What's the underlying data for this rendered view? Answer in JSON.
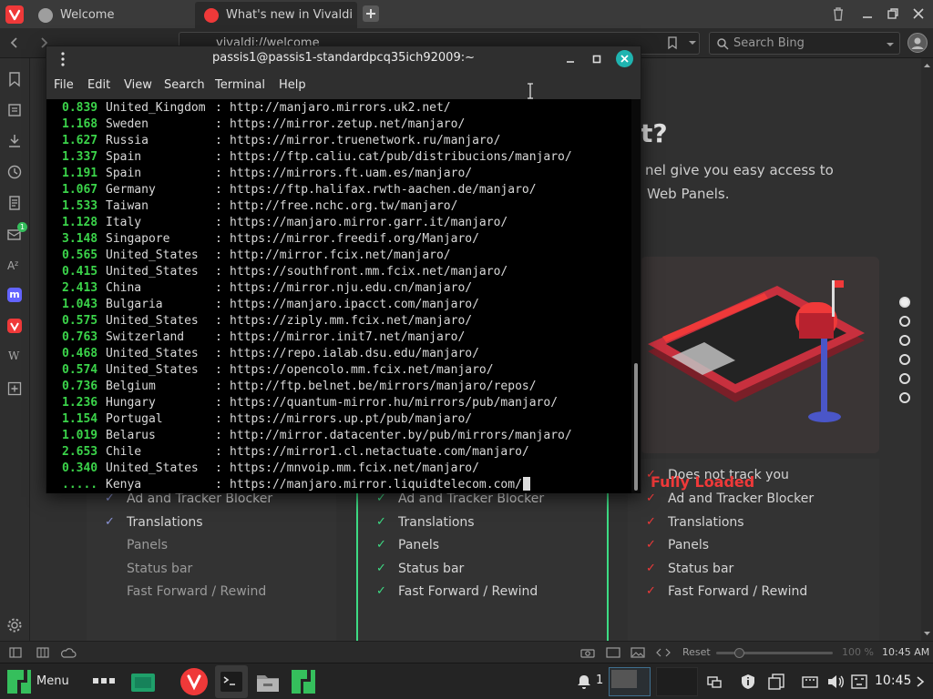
{
  "browser": {
    "tabs": [
      {
        "label": "Welcome"
      },
      {
        "label": "What's new in Vivaldi | Viva"
      }
    ],
    "address": "vivaldi://welcome",
    "search_placeholder": "Search Bing"
  },
  "terminal": {
    "title": "passis1@passis1-standardpcq35ich92009:~",
    "menu": [
      "File",
      "Edit",
      "View",
      "Search",
      "Terminal",
      "Help"
    ],
    "rows": [
      {
        "score": "0.839",
        "country": "United_Kingdom",
        "url": "http://manjaro.mirrors.uk2.net/"
      },
      {
        "score": "1.168",
        "country": "Sweden",
        "url": "https://mirror.zetup.net/manjaro/"
      },
      {
        "score": "1.627",
        "country": "Russia",
        "url": "https://mirror.truenetwork.ru/manjaro/"
      },
      {
        "score": "1.337",
        "country": "Spain",
        "url": "https://ftp.caliu.cat/pub/distribucions/manjaro/"
      },
      {
        "score": "1.191",
        "country": "Spain",
        "url": "https://mirrors.ft.uam.es/manjaro/"
      },
      {
        "score": "1.067",
        "country": "Germany",
        "url": "https://ftp.halifax.rwth-aachen.de/manjaro/"
      },
      {
        "score": "1.533",
        "country": "Taiwan",
        "url": "http://free.nchc.org.tw/manjaro/"
      },
      {
        "score": "1.128",
        "country": "Italy",
        "url": "https://manjaro.mirror.garr.it/manjaro/"
      },
      {
        "score": "3.148",
        "country": "Singapore",
        "url": "https://mirror.freedif.org/Manjaro/"
      },
      {
        "score": "0.565",
        "country": "United_States",
        "url": "http://mirror.fcix.net/manjaro/"
      },
      {
        "score": "0.415",
        "country": "United_States",
        "url": "https://southfront.mm.fcix.net/manjaro/"
      },
      {
        "score": "2.413",
        "country": "China",
        "url": "https://mirror.nju.edu.cn/manjaro/"
      },
      {
        "score": "1.043",
        "country": "Bulgaria",
        "url": "https://manjaro.ipacct.com/manjaro/"
      },
      {
        "score": "0.575",
        "country": "United_States",
        "url": "https://ziply.mm.fcix.net/manjaro/"
      },
      {
        "score": "0.763",
        "country": "Switzerland",
        "url": "https://mirror.init7.net/manjaro/"
      },
      {
        "score": "0.468",
        "country": "United_States",
        "url": "https://repo.ialab.dsu.edu/manjaro/"
      },
      {
        "score": "0.574",
        "country": "United_States",
        "url": "https://opencolo.mm.fcix.net/manjaro/"
      },
      {
        "score": "0.736",
        "country": "Belgium",
        "url": "http://ftp.belnet.be/mirrors/manjaro/repos/"
      },
      {
        "score": "1.236",
        "country": "Hungary",
        "url": "https://quantum-mirror.hu/mirrors/pub/manjaro/"
      },
      {
        "score": "1.154",
        "country": "Portugal",
        "url": "https://mirrors.up.pt/pub/manjaro/"
      },
      {
        "score": "1.019",
        "country": "Belarus",
        "url": "http://mirror.datacenter.by/pub/mirrors/manjaro/"
      },
      {
        "score": "2.653",
        "country": "Chile",
        "url": "https://mirror1.cl.netactuate.com/manjaro/"
      },
      {
        "score": "0.340",
        "country": "United_States",
        "url": "https://mnvoip.mm.fcix.net/manjaro/"
      },
      {
        "score": ".....",
        "country": "Kenya",
        "url": "https://manjaro.mirror.liquidtelecom.com/"
      }
    ],
    "separator": ":"
  },
  "page": {
    "heading_fragment": "t?",
    "text_line1": "nel give you easy access to",
    "text_line2": "Web Panels.",
    "fully_loaded": "Fully Loaded",
    "columns": [
      {
        "checks": [
          "✓",
          "✓",
          "✓",
          "",
          "",
          ""
        ],
        "dim": [
          false,
          false,
          false,
          true,
          true,
          true
        ],
        "check_color": "#8a93d6"
      },
      {
        "checks": [
          "✓",
          "✓",
          "✓",
          "✓",
          "✓",
          "✓"
        ],
        "dim": [
          false,
          false,
          false,
          false,
          false,
          false
        ],
        "check_color": "#3ddc84"
      },
      {
        "checks": [
          "✓",
          "✓",
          "✓",
          "✓",
          "✓",
          "✓"
        ],
        "dim": [
          false,
          false,
          false,
          false,
          false,
          false
        ],
        "check_color": "#ef3939"
      }
    ],
    "features": [
      "Does not track you",
      "Ad and Tracker Blocker",
      "Translations",
      "Panels",
      "Status bar",
      "Fast Forward / Rewind"
    ],
    "slides": {
      "count": 6,
      "active": 0
    }
  },
  "statusbar": {
    "zoom_reset": "Reset",
    "zoom": "100 %",
    "clock": "10:45 AM"
  },
  "taskbar": {
    "menu_label": "Menu",
    "notification_count": "1",
    "clock": "10:45"
  },
  "colors": {
    "vivaldi_red": "#ef3939",
    "manjaro_green": "#35bf5c",
    "terminal_score": "#3bd34a"
  }
}
